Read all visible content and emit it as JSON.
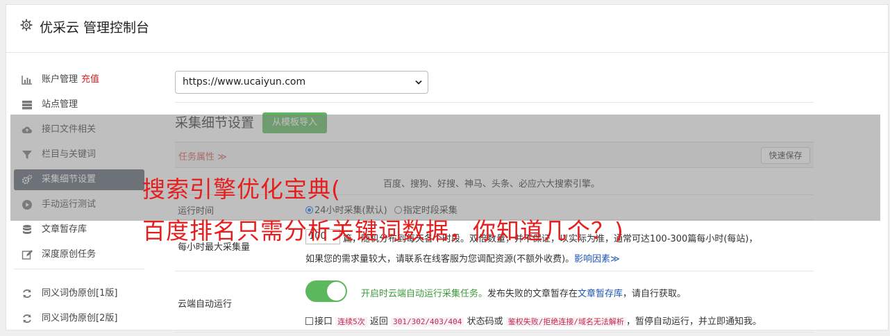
{
  "header": {
    "title": "优采云 管理控制台",
    "icon": "gear-icon"
  },
  "sidebar": {
    "items": [
      {
        "label": "账户管理",
        "badge": "充值",
        "icon": "bar-chart-icon"
      },
      {
        "label": "站点管理",
        "icon": "server-icon"
      },
      {
        "label": "接口文件相关",
        "icon": "cloud-upload-icon"
      },
      {
        "label": "栏目与关键词",
        "icon": "filter-icon"
      },
      {
        "label": "采集细节设置",
        "icon": "gears-icon"
      },
      {
        "label": "手动运行测试",
        "icon": "play-icon"
      },
      {
        "label": "文章暂存库",
        "icon": "database-icon"
      },
      {
        "label": "深度原创任务",
        "icon": "edit-icon"
      },
      {
        "label": "同义词伪原创[1版]",
        "icon": "refresh-icon"
      },
      {
        "label": "同义词伪原创[2版]",
        "icon": "refresh-icon"
      }
    ]
  },
  "site_select": {
    "value": "https://www.ucaiyun.com"
  },
  "section": {
    "title": "采集细节设置",
    "import_button": "从模板导入"
  },
  "table": {
    "task_attr": "任务属性 ≫",
    "quick_save": "快速保存",
    "rows": {
      "engine_text": "百度、搜狗、好搜、神马、头条、必应六大搜索引擎。",
      "run_time_label": "运行时间",
      "run_opt1": "24小时采集(默认)",
      "run_opt2": "指定时段采集",
      "max_label": "每小时最大采集量",
      "max_value": "100",
      "max_text": "篇，随机分布到每天各个时段。双倍数量，并不保证，以实际为准，通常可达100-300篇每小时(每站)，",
      "max_text2": "如果您的需求量较大，请联系在线客服为您调配资源(不额外收费)。",
      "influence": "影响因素≫",
      "cloud_label": "云端自动运行",
      "cloud_green": "开启时云端自动运行采集任务。",
      "cloud_text": "发布失败的文章暂存在",
      "cloud_link": "文章暂存库",
      "cloud_text2": "，请自行获取。",
      "api_prefix": "接口",
      "api_code1": "连续5次",
      "api_mid": "返回",
      "api_code2": "301/302/403/404",
      "api_mid2": "状态码或",
      "api_code3": "鉴权失败/拒绝连接/域名无法解析",
      "api_suffix": "，暂停自动运行，并立即通知我。"
    }
  },
  "watermark": {
    "line1": "搜索引擎优化宝典(",
    "line2": "百度排名只需分析关键词数据，你知道几个？)"
  }
}
